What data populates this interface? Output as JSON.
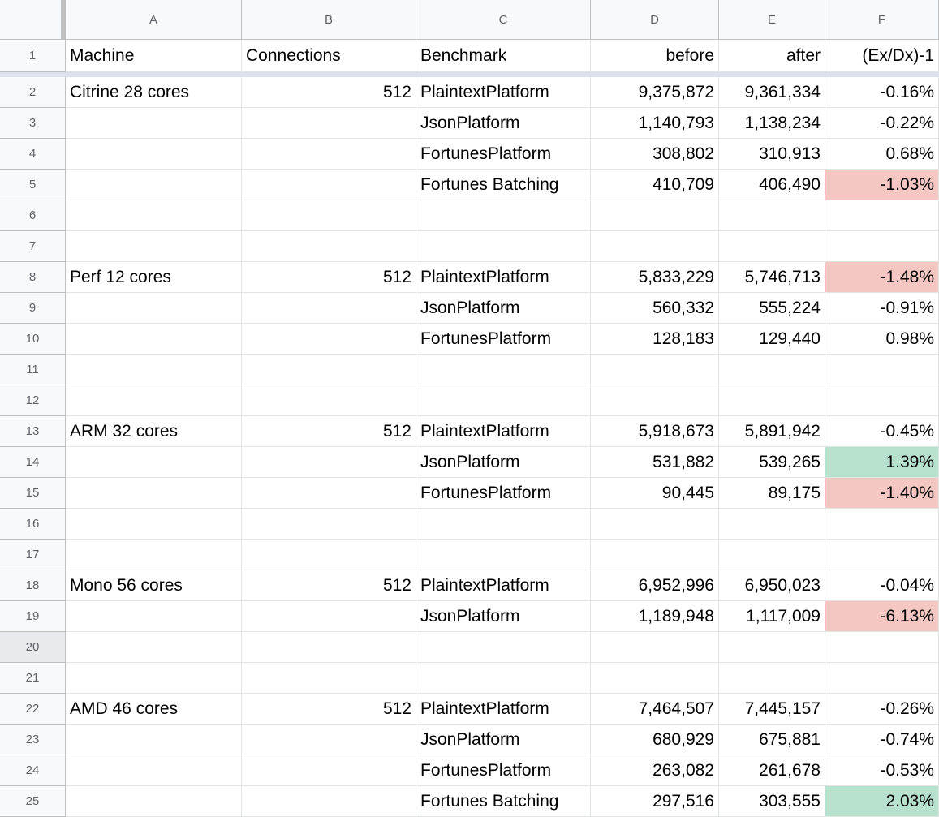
{
  "sheet": {
    "columns": [
      "A",
      "B",
      "C",
      "D",
      "E",
      "F"
    ],
    "header_row": {
      "number": "1",
      "cells": [
        "Machine",
        "Connections",
        "Benchmark",
        "before",
        "after",
        "(Ex/Dx)-1"
      ]
    },
    "selected_row": "20",
    "rows": [
      {
        "number": "2",
        "machine": "Citrine 28 cores",
        "connections": "512",
        "benchmark": "PlaintextPlatform",
        "before": "9,375,872",
        "after": "9,361,334",
        "delta": "-0.16%",
        "highlight": ""
      },
      {
        "number": "3",
        "machine": "",
        "connections": "",
        "benchmark": "JsonPlatform",
        "before": "1,140,793",
        "after": "1,138,234",
        "delta": "-0.22%",
        "highlight": ""
      },
      {
        "number": "4",
        "machine": "",
        "connections": "",
        "benchmark": "FortunesPlatform",
        "before": "308,802",
        "after": "310,913",
        "delta": "0.68%",
        "highlight": ""
      },
      {
        "number": "5",
        "machine": "",
        "connections": "",
        "benchmark": "Fortunes Batching",
        "before": "410,709",
        "after": "406,490",
        "delta": "-1.03%",
        "highlight": "red"
      },
      {
        "number": "6",
        "machine": "",
        "connections": "",
        "benchmark": "",
        "before": "",
        "after": "",
        "delta": "",
        "highlight": ""
      },
      {
        "number": "7",
        "machine": "",
        "connections": "",
        "benchmark": "",
        "before": "",
        "after": "",
        "delta": "",
        "highlight": ""
      },
      {
        "number": "8",
        "machine": "Perf 12 cores",
        "connections": "512",
        "benchmark": "PlaintextPlatform",
        "before": "5,833,229",
        "after": "5,746,713",
        "delta": "-1.48%",
        "highlight": "red"
      },
      {
        "number": "9",
        "machine": "",
        "connections": "",
        "benchmark": "JsonPlatform",
        "before": "560,332",
        "after": "555,224",
        "delta": "-0.91%",
        "highlight": ""
      },
      {
        "number": "10",
        "machine": "",
        "connections": "",
        "benchmark": "FortunesPlatform",
        "before": "128,183",
        "after": "129,440",
        "delta": "0.98%",
        "highlight": ""
      },
      {
        "number": "11",
        "machine": "",
        "connections": "",
        "benchmark": "",
        "before": "",
        "after": "",
        "delta": "",
        "highlight": ""
      },
      {
        "number": "12",
        "machine": "",
        "connections": "",
        "benchmark": "",
        "before": "",
        "after": "",
        "delta": "",
        "highlight": ""
      },
      {
        "number": "13",
        "machine": "ARM 32 cores",
        "connections": "512",
        "benchmark": "PlaintextPlatform",
        "before": "5,918,673",
        "after": "5,891,942",
        "delta": "-0.45%",
        "highlight": ""
      },
      {
        "number": "14",
        "machine": "",
        "connections": "",
        "benchmark": "JsonPlatform",
        "before": "531,882",
        "after": "539,265",
        "delta": "1.39%",
        "highlight": "green"
      },
      {
        "number": "15",
        "machine": "",
        "connections": "",
        "benchmark": "FortunesPlatform",
        "before": "90,445",
        "after": "89,175",
        "delta": "-1.40%",
        "highlight": "red"
      },
      {
        "number": "16",
        "machine": "",
        "connections": "",
        "benchmark": "",
        "before": "",
        "after": "",
        "delta": "",
        "highlight": ""
      },
      {
        "number": "17",
        "machine": "",
        "connections": "",
        "benchmark": "",
        "before": "",
        "after": "",
        "delta": "",
        "highlight": ""
      },
      {
        "number": "18",
        "machine": "Mono 56 cores",
        "connections": "512",
        "benchmark": "PlaintextPlatform",
        "before": "6,952,996",
        "after": "6,950,023",
        "delta": "-0.04%",
        "highlight": ""
      },
      {
        "number": "19",
        "machine": "",
        "connections": "",
        "benchmark": "JsonPlatform",
        "before": "1,189,948",
        "after": "1,117,009",
        "delta": "-6.13%",
        "highlight": "red"
      },
      {
        "number": "20",
        "machine": "",
        "connections": "",
        "benchmark": "",
        "before": "",
        "after": "",
        "delta": "",
        "highlight": ""
      },
      {
        "number": "21",
        "machine": "",
        "connections": "",
        "benchmark": "",
        "before": "",
        "after": "",
        "delta": "",
        "highlight": ""
      },
      {
        "number": "22",
        "machine": "AMD 46 cores",
        "connections": "512",
        "benchmark": "PlaintextPlatform",
        "before": "7,464,507",
        "after": "7,445,157",
        "delta": "-0.26%",
        "highlight": ""
      },
      {
        "number": "23",
        "machine": "",
        "connections": "",
        "benchmark": "JsonPlatform",
        "before": "680,929",
        "after": "675,881",
        "delta": "-0.74%",
        "highlight": ""
      },
      {
        "number": "24",
        "machine": "",
        "connections": "",
        "benchmark": "FortunesPlatform",
        "before": "263,082",
        "after": "261,678",
        "delta": "-0.53%",
        "highlight": ""
      },
      {
        "number": "25",
        "machine": "",
        "connections": "",
        "benchmark": "Fortunes Batching",
        "before": "297,516",
        "after": "303,555",
        "delta": "2.03%",
        "highlight": "green"
      }
    ]
  },
  "colors": {
    "header_bg": "#f8f9fa",
    "gridline": "#e2e3e3",
    "header_border": "#c0c0c0",
    "freeze_bar": "#dbe2ee",
    "negative_highlight": "#f4c7c3",
    "positive_highlight": "#b7e1cd"
  }
}
